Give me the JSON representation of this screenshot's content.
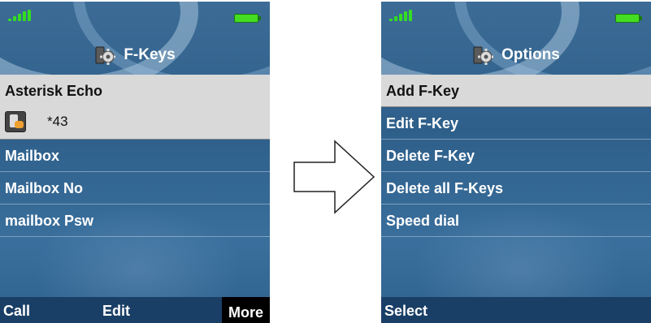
{
  "left_phone": {
    "title": "F-Keys",
    "icon": "settings-gear-icon",
    "items": [
      {
        "label": "Asterisk Echo",
        "code": "*43",
        "selected": true
      },
      {
        "label": "Mailbox"
      },
      {
        "label": "Mailbox No"
      },
      {
        "label": "mailbox Psw"
      }
    ],
    "softkeys": {
      "left": "Call",
      "center": "Edit",
      "right": "More"
    }
  },
  "right_phone": {
    "title": "Options",
    "icon": "settings-gear-icon",
    "items": [
      {
        "label": "Add F-Key",
        "selected": true
      },
      {
        "label": "Edit F-Key"
      },
      {
        "label": "Delete F-Key"
      },
      {
        "label": "Delete all F-Keys"
      },
      {
        "label": "Speed dial"
      }
    ],
    "softkeys": {
      "left": "Select"
    }
  },
  "arrow_icon": "right-arrow-icon",
  "colors": {
    "screen_bg": "#2e5f8a",
    "selected_row": "#d9d9d9",
    "softbar": "#1a3f66",
    "signal": "#33dd22",
    "battery": "#44dd22"
  }
}
